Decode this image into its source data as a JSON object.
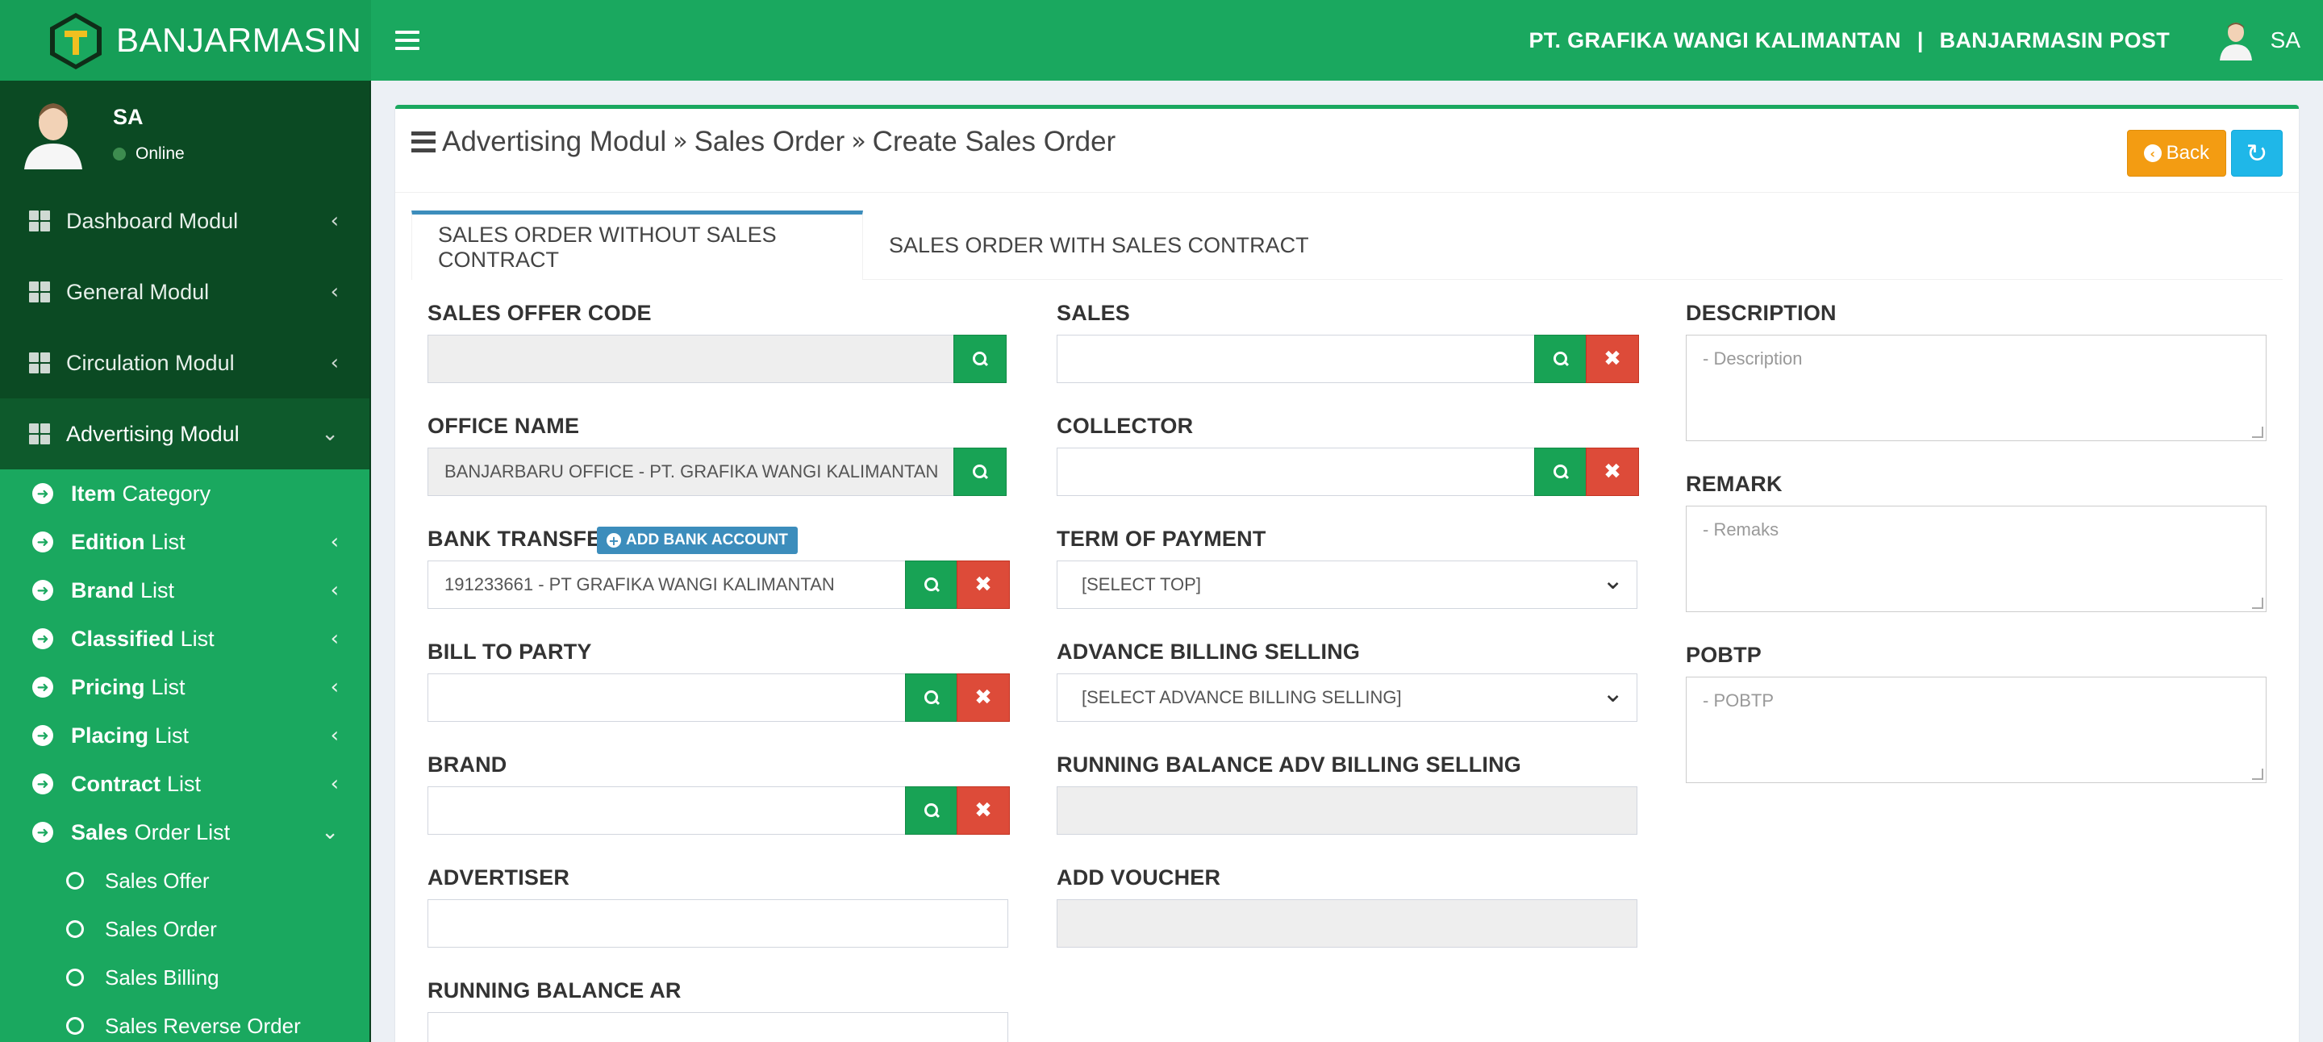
{
  "header": {
    "brand": "BANJARMASIN",
    "company": "PT. GRAFIKA WANGI KALIMANTAN",
    "separator": "|",
    "publication": "BANJARMASIN POST",
    "user": "SA"
  },
  "sidebar": {
    "user_name": "SA",
    "user_status": "Online",
    "menu": [
      {
        "label": "Dashboard Modul"
      },
      {
        "label": "General Modul"
      },
      {
        "label": "Circulation Modul"
      },
      {
        "label": "Advertising Modul"
      }
    ],
    "sub": [
      {
        "bold": "Item",
        "rest": "Category"
      },
      {
        "bold": "Edition",
        "rest": "List"
      },
      {
        "bold": "Brand",
        "rest": "List"
      },
      {
        "bold": "Classified",
        "rest": "List"
      },
      {
        "bold": "Pricing",
        "rest": "List"
      },
      {
        "bold": "Placing",
        "rest": "List"
      },
      {
        "bold": "Contract",
        "rest": "List"
      },
      {
        "bold": "Sales",
        "rest": "Order List"
      }
    ],
    "subsub": [
      "Sales Offer",
      "Sales Order",
      "Sales Billing",
      "Sales Reverse Order"
    ]
  },
  "breadcrumb": {
    "part1": "Advertising Modul",
    "part2": "Sales Order",
    "part3": "Create Sales Order",
    "sep": "»"
  },
  "buttons": {
    "back": "Back"
  },
  "tabs": [
    "SALES ORDER WITHOUT SALES CONTRACT",
    "SALES ORDER WITH SALES CONTRACT"
  ],
  "form": {
    "sales_offer_code": {
      "label": "SALES OFFER CODE",
      "value": ""
    },
    "office_name": {
      "label": "OFFICE NAME",
      "value": "BANJARBARU OFFICE - PT. GRAFIKA WANGI KALIMANTAN"
    },
    "bank_transfer": {
      "label": "BANK TRANSFER",
      "add_label": "ADD BANK ACCOUNT",
      "value": "191233661 - PT GRAFIKA WANGI KALIMANTAN"
    },
    "bill_to_party": {
      "label": "BILL TO PARTY",
      "value": ""
    },
    "brand": {
      "label": "BRAND",
      "value": ""
    },
    "advertiser": {
      "label": "ADVERTISER",
      "value": ""
    },
    "running_balance_ar": {
      "label": "RUNNING BALANCE AR",
      "value": ""
    },
    "sales": {
      "label": "SALES",
      "value": ""
    },
    "collector": {
      "label": "COLLECTOR",
      "value": ""
    },
    "term_of_payment": {
      "label": "TERM OF PAYMENT",
      "value": "[SELECT TOP]"
    },
    "advance_billing_selling": {
      "label": "ADVANCE BILLING SELLING",
      "value": "[SELECT ADVANCE BILLING SELLING]"
    },
    "running_balance_adv": {
      "label": "RUNNING BALANCE ADV BILLING SELLING",
      "value": ""
    },
    "add_voucher": {
      "label": "ADD VOUCHER",
      "value": ""
    },
    "description": {
      "label": "DESCRIPTION",
      "placeholder": "- Description"
    },
    "remark": {
      "label": "REMARK",
      "placeholder": "- Remaks"
    },
    "pobtp": {
      "label": "POBTP",
      "placeholder": "- POBTP"
    }
  },
  "colors": {
    "brand_green": "#1aa85f",
    "sidebar_dark": "#0b4a23",
    "back_orange": "#f39c12",
    "refresh_blue": "#1fb7e8",
    "delete_red": "#dd4b39",
    "tab_blue": "#3c8dbc"
  },
  "icons": {
    "menu": "hamburger-icon",
    "search": "search-icon",
    "clear": "times-icon",
    "back": "arrow-circle-left-icon",
    "refresh": "refresh-icon"
  }
}
